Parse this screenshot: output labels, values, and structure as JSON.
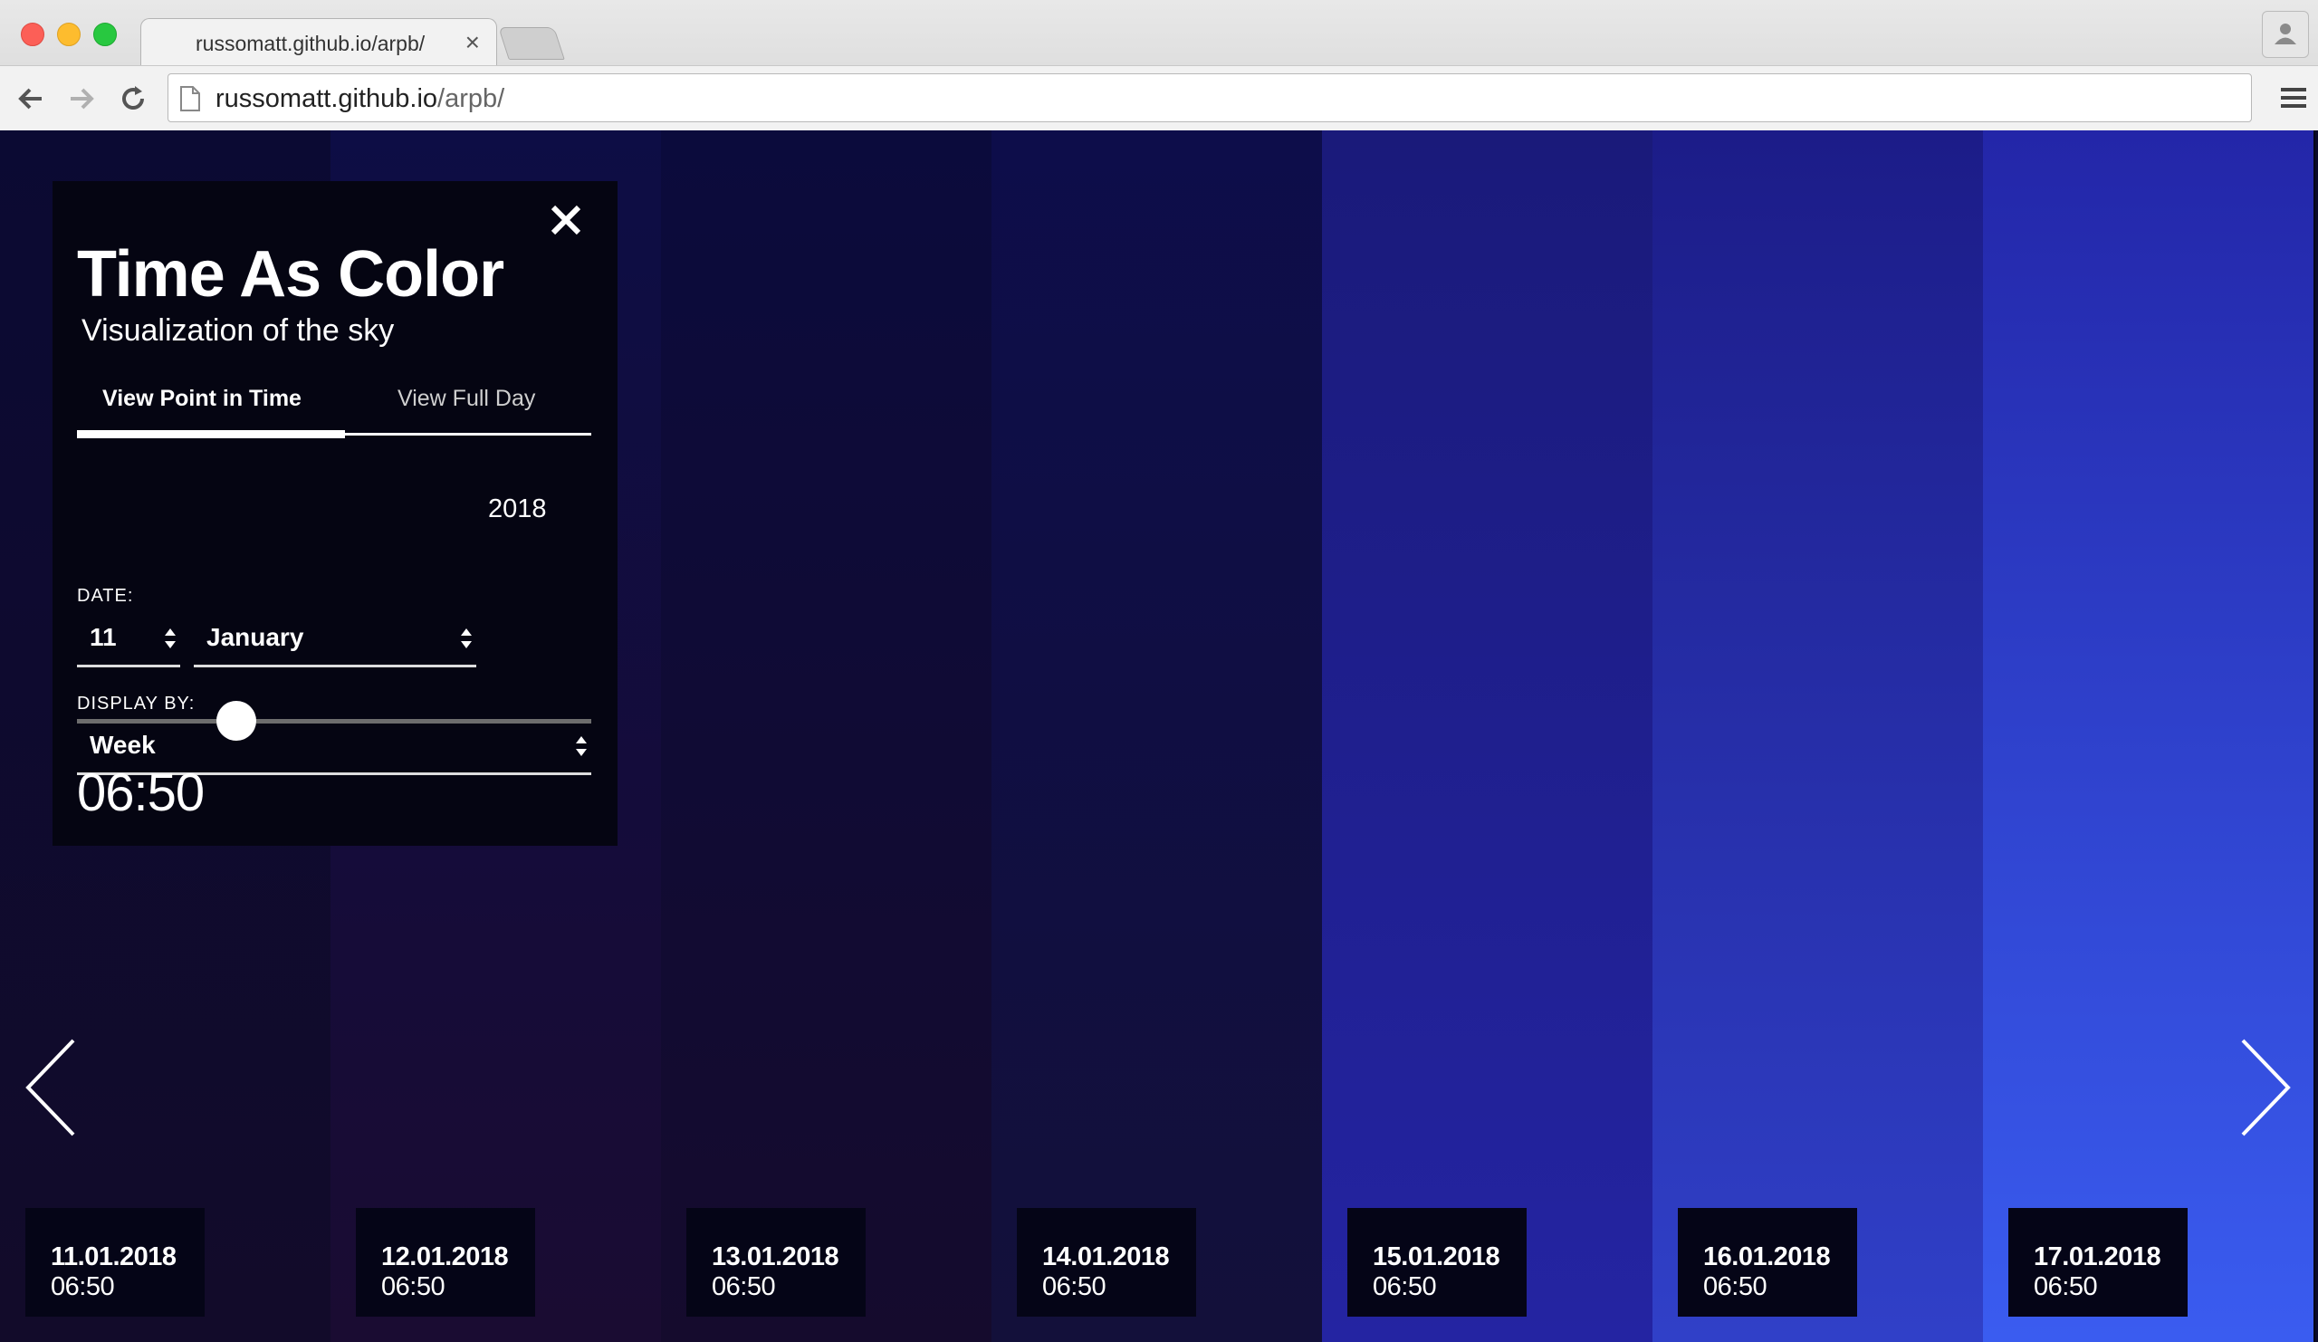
{
  "browser": {
    "tab_title": "russomatt.github.io/arpb/",
    "tab_close": "×",
    "url_host": "russomatt.github.io",
    "url_path": "/arpb/"
  },
  "panel": {
    "title": "Time As Color",
    "subtitle": "Visualization of the sky",
    "tabs": [
      "View Point in Time",
      "View Full Day"
    ],
    "active_tab": 0,
    "date_label": "DATE:",
    "day": "11",
    "month": "January",
    "year": "2018",
    "display_label": "DISPLAY BY:",
    "display_value": "Week",
    "slider_fraction": 0.31,
    "time": "06:50"
  },
  "days": [
    {
      "date": "11.01.2018",
      "time": "06:50",
      "top": "#0b0a33",
      "bottom": "#120b2a"
    },
    {
      "date": "12.01.2018",
      "time": "06:50",
      "top": "#0d0d45",
      "bottom": "#1a0c32"
    },
    {
      "date": "13.01.2018",
      "time": "06:50",
      "top": "#0b0b3c",
      "bottom": "#150b2d"
    },
    {
      "date": "14.01.2018",
      "time": "06:50",
      "top": "#0d0d4a",
      "bottom": "#13103a"
    },
    {
      "date": "15.01.2018",
      "time": "06:50",
      "top": "#1a1a7a",
      "bottom": "#2424a2"
    },
    {
      "date": "16.01.2018",
      "time": "06:50",
      "top": "#1c1c88",
      "bottom": "#3040c8"
    },
    {
      "date": "17.01.2018",
      "time": "06:50",
      "top": "#2326a8",
      "bottom": "#3a5cf0"
    }
  ]
}
